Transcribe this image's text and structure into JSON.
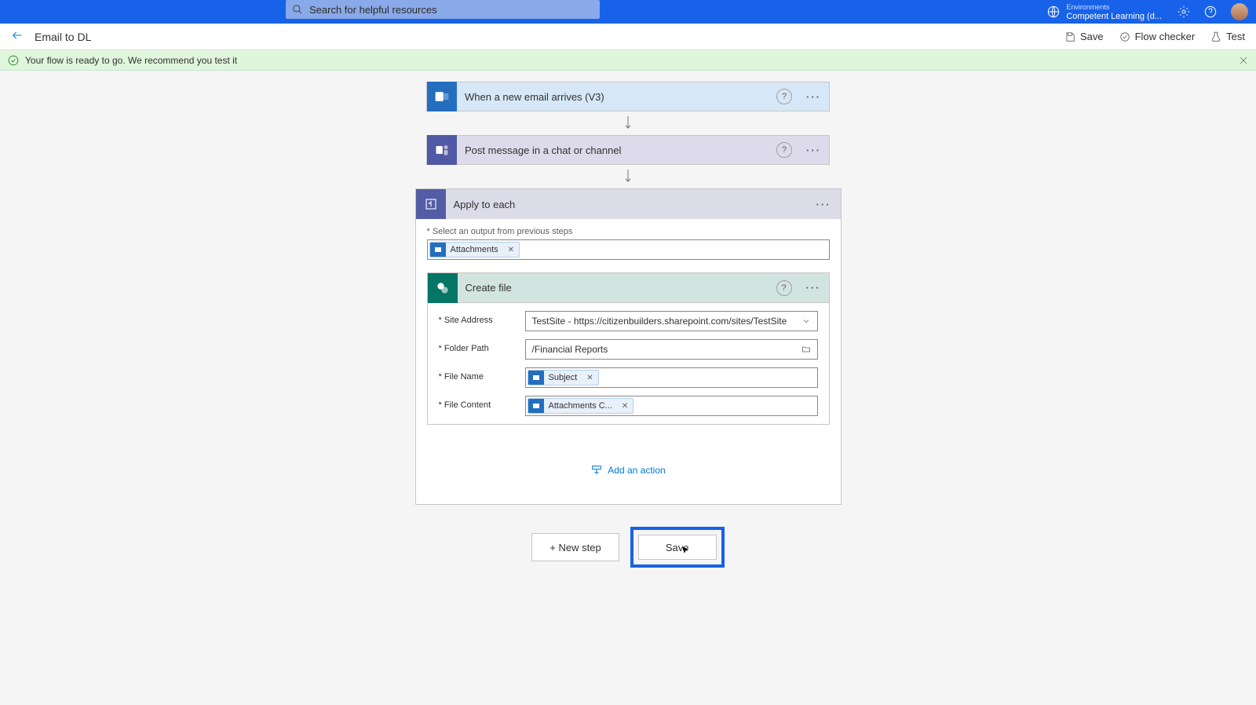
{
  "topbar": {
    "search_placeholder": "Search for helpful resources",
    "env_label": "Environments",
    "env_name": "Competent Learning (d..."
  },
  "subhead": {
    "title": "Email to DL",
    "save": "Save",
    "checker": "Flow checker",
    "test": "Test"
  },
  "notif": {
    "text": "Your flow is ready to go. We recommend you test it"
  },
  "steps": {
    "trigger": "When a new email arrives (V3)",
    "teams": "Post message in a chat or channel",
    "apply": "Apply to each",
    "create_file": "Create file"
  },
  "apply": {
    "select_label": "* Select an output from previous steps",
    "token_attachments": "Attachments"
  },
  "create_file": {
    "site_label": "* Site Address",
    "site_value": "TestSite - https://citizenbuilders.sharepoint.com/sites/TestSite",
    "folder_label": "* Folder Path",
    "folder_value": "/Financial Reports",
    "name_label": "* File Name",
    "name_token": "Subject",
    "content_label": "* File Content",
    "content_token": "Attachments C..."
  },
  "actions": {
    "add_action": "Add an action",
    "new_step": "+ New step",
    "save": "Save"
  }
}
